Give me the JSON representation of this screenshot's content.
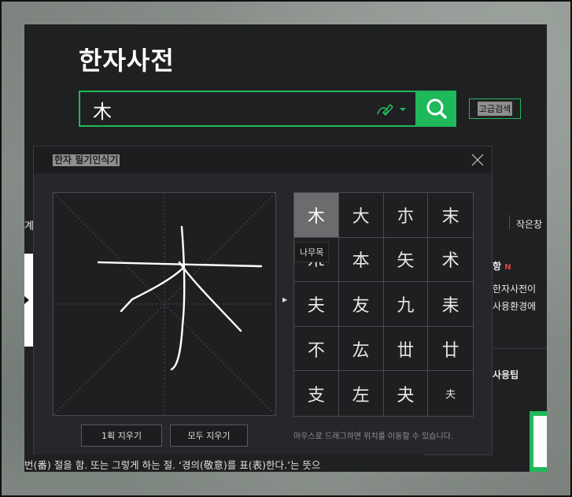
{
  "page": {
    "title": "한자사전",
    "search_value": "木",
    "advanced_search_label": "고급검색"
  },
  "colors": {
    "accent": "#1fb85a",
    "panel_bg": "#1f2022",
    "selected_cell": "#6a6c6e",
    "notice_badge": "#e84040"
  },
  "underlying": {
    "small_window_label": "작은창",
    "notice_title": "항",
    "notice_badge": "N",
    "notice_line1": "한자사전이",
    "notice_line2": "사용환경에",
    "tips_title": "사용팁",
    "left_edge_label": "계",
    "meaning_line": "번(番) 절을 함. 또는 그렇게 하는 절. ‘경의(敬意)를 표(表)한다.’는 뜻으"
  },
  "modal": {
    "title": "한자 필기인식기",
    "candidates": [
      "木",
      "大",
      "朩",
      "末",
      "𣎳",
      "本",
      "矢",
      "术",
      "夫",
      "友",
      "九",
      "耒",
      "不",
      "厷",
      "丗",
      "廿",
      "支",
      "左",
      "夬",
      "夫"
    ],
    "selected_index": 0,
    "tooltip": "나무목",
    "clear_one_label": "1획 지우기",
    "clear_all_label": "모두 지우기",
    "hint": "마우스로 드래그하면 위치를 이동할 수 있습니다."
  }
}
